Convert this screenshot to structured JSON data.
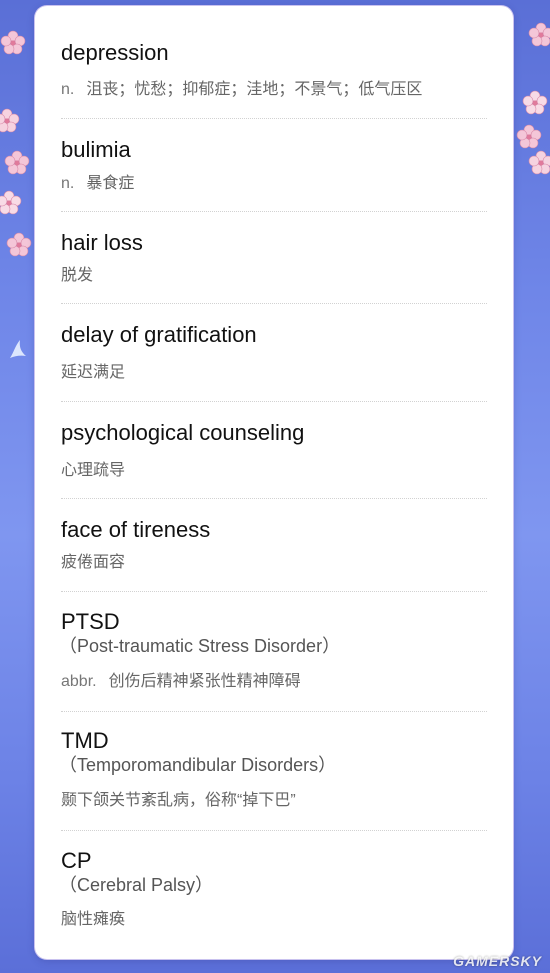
{
  "entries": [
    {
      "word": "depression",
      "pos": "n.",
      "definition": "沮丧；忧愁；抑郁症；洼地；不景气；低气压区"
    },
    {
      "word": "bulimia",
      "pos": "n.",
      "definition": "暴食症"
    },
    {
      "word": "hair loss",
      "definition": "脱发"
    },
    {
      "word": "delay of gratification",
      "definition": "延迟满足"
    },
    {
      "word": "psychological counseling",
      "definition": "心理疏导"
    },
    {
      "word": "face of tireness",
      "definition": "疲倦面容"
    },
    {
      "word": "PTSD",
      "full": "（Post-traumatic Stress Disorder）",
      "pos": "abbr.",
      "definition": "创伤后精神紧张性精神障碍"
    },
    {
      "word": "TMD",
      "full": "（Temporomandibular Disorders）",
      "definition": "颞下颌关节紊乱病，俗称“掉下巴”"
    },
    {
      "word": "CP",
      "full": "（Cerebral Palsy）",
      "definition": "脑性瘫痪"
    }
  ],
  "decor": {
    "blossom_icon": "cherry-blossom-icon",
    "bird_icon": "bird-icon",
    "accent_color": "#6f86e8",
    "blossom_color": "#f4c6d8"
  },
  "watermark": "GAMERSKY"
}
